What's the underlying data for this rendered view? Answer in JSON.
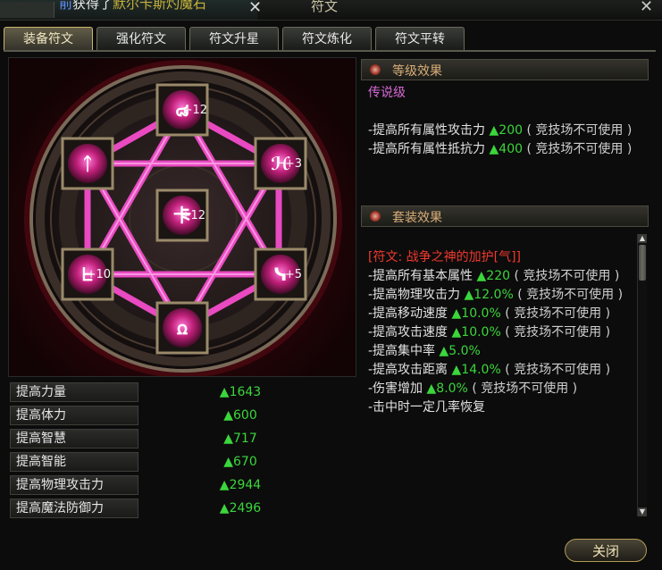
{
  "notice": {
    "prefix": "前",
    "text": "获得了",
    "item": "默尔卡斯灼魔石",
    "close": "✕"
  },
  "window": {
    "title": "符文",
    "close": "✕"
  },
  "tabs": [
    {
      "label": "装备符文",
      "active": true
    },
    {
      "label": "强化符文",
      "active": false
    },
    {
      "label": "符文升星",
      "active": false
    },
    {
      "label": "符文炼化",
      "active": false
    },
    {
      "label": "符文平转",
      "active": false
    }
  ],
  "runes": [
    {
      "glyph": "๘",
      "level": "+12"
    },
    {
      "glyph": "ℋ",
      "level": "+3"
    },
    {
      "glyph": "ᓭ",
      "level": "+5"
    },
    {
      "glyph": "ꭥ",
      "level": ""
    },
    {
      "glyph": "ᖶ",
      "level": "+10"
    },
    {
      "glyph": "ᛏ",
      "level": ""
    },
    {
      "glyph": "卡",
      "level": "+12"
    }
  ],
  "stats": [
    {
      "name": "提高力量",
      "value": "▲1643"
    },
    {
      "name": "提高体力",
      "value": "▲600"
    },
    {
      "name": "提高智慧",
      "value": "▲717"
    },
    {
      "name": "提高智能",
      "value": "▲670"
    },
    {
      "name": "提高物理攻击力",
      "value": "▲2944"
    },
    {
      "name": "提高魔法防御力",
      "value": "▲2496"
    }
  ],
  "level_effect": {
    "header": "等级效果",
    "grade": "传说级",
    "lines": [
      {
        "text": "-提高所有属性攻击力 ",
        "value": "▲200",
        "note": "( 竞技场不可使用 )"
      },
      {
        "text": "-提高所有属性抵抗力 ",
        "value": "▲400",
        "note": "( 竞技场不可使用 )"
      }
    ]
  },
  "set_effect": {
    "header": "套装效果",
    "set_name": "[符文: 战争之神的加护[气]]",
    "lines": [
      {
        "text": "-提高所有基本属性 ",
        "value": "▲220",
        "note": "( 竞技场不可使用 )"
      },
      {
        "text": "-提高物理攻击力 ",
        "value": "▲12.0%",
        "note": "( 竞技场不可使用 )"
      },
      {
        "text": "-提高移动速度 ",
        "value": "▲10.0%",
        "note": "( 竞技场不可使用 )"
      },
      {
        "text": "-提高攻击速度 ",
        "value": "▲10.0%",
        "note": "( 竞技场不可使用 )"
      },
      {
        "text": "-提高集中率 ",
        "value": "▲5.0%",
        "note": ""
      },
      {
        "text": "-提高攻击距离 ",
        "value": "▲14.0%",
        "note": "( 竞技场不可使用 )"
      },
      {
        "text": "-伤害增加 ",
        "value": "▲8.0%",
        "note": "( 竞技场不可使用 )"
      }
    ],
    "truncated": "-击中时一定几率恢复"
  },
  "close_button": "关闭",
  "colors": {
    "accent_gold": "#c9b46a",
    "stat_green": "#3bd63b",
    "pink_line": "#ff55d8",
    "red_set": "#f0392e",
    "purple_grade": "#d66ad6"
  },
  "scroll": {
    "up": "▲",
    "down": "▼"
  }
}
